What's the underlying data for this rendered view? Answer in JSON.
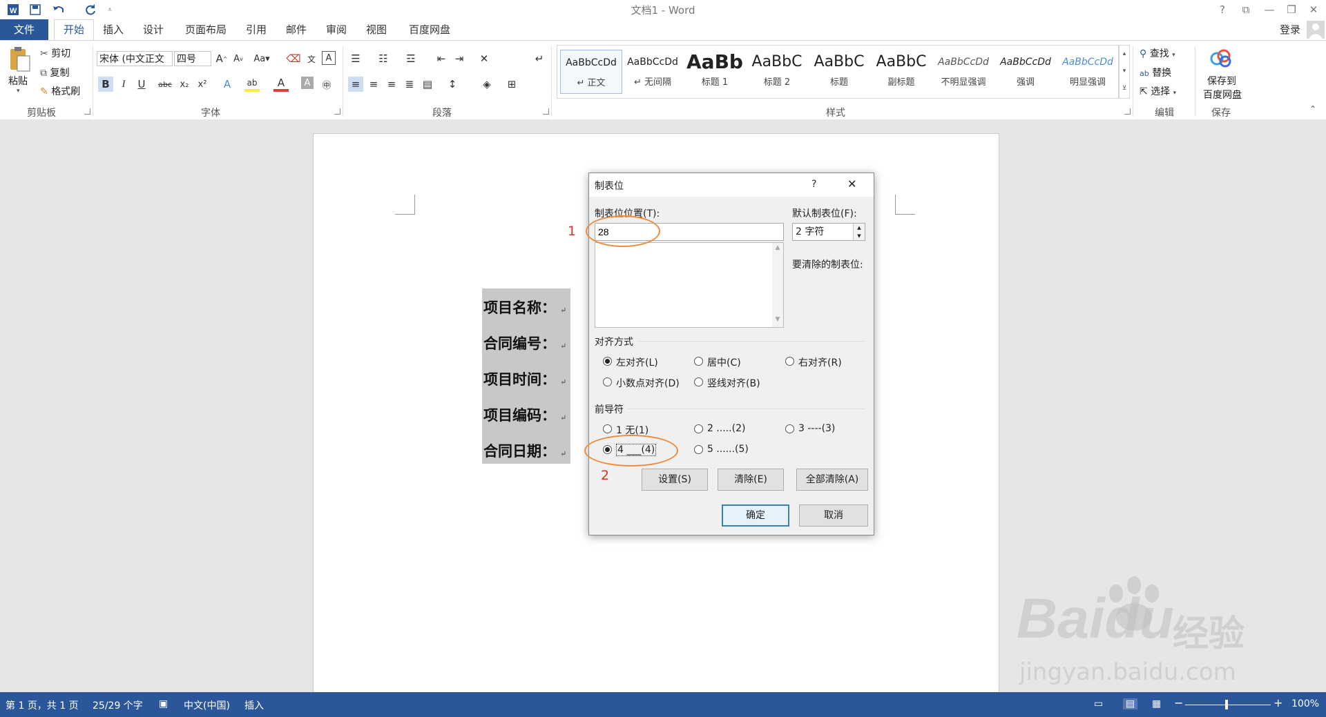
{
  "titlebar": {
    "title": "文档1 - Word",
    "qat_icons": [
      "word-logo-icon",
      "save-icon",
      "undo-icon",
      "redo-icon",
      "customize-qat-icon"
    ],
    "window_buttons": {
      "help": "?",
      "ribbon_options": "⧉",
      "minimize": "—",
      "restore": "❐",
      "close": "✕"
    }
  },
  "tabs": {
    "file": "文件",
    "home": "开始",
    "insert": "插入",
    "design": "设计",
    "layout": "页面布局",
    "references": "引用",
    "mailings": "邮件",
    "review": "审阅",
    "view": "视图",
    "baidu": "百度网盘",
    "login": "登录"
  },
  "ribbon": {
    "clipboard": {
      "paste": "粘贴",
      "cut": "剪切",
      "copy": "复制",
      "format_painter": "格式刷",
      "label": "剪贴板"
    },
    "font": {
      "font_name": "宋体 (中文正文",
      "font_size": "四号",
      "label": "字体"
    },
    "paragraph": {
      "label": "段落"
    },
    "styles": {
      "label": "样式",
      "items": [
        {
          "sample": "AaBbCcDd",
          "name": "↵ 正文"
        },
        {
          "sample": "AaBbCcDd",
          "name": "↵ 无间隔"
        },
        {
          "sample": "AaBb",
          "name": "标题 1"
        },
        {
          "sample": "AaBbC",
          "name": "标题 2"
        },
        {
          "sample": "AaBbC",
          "name": "标题"
        },
        {
          "sample": "AaBbC",
          "name": "副标题"
        },
        {
          "sample": "AaBbCcDd",
          "name": "不明显强调"
        },
        {
          "sample": "AaBbCcDd",
          "name": "强调"
        },
        {
          "sample": "AaBbCcDd",
          "name": "明显强调"
        }
      ]
    },
    "editing": {
      "find": "查找",
      "replace": "替换",
      "select": "选择",
      "label": "编辑"
    },
    "save": {
      "line1": "保存到",
      "line2": "百度网盘",
      "label": "保存"
    }
  },
  "document": {
    "lines": [
      "项目名称：",
      "合同编号：",
      "项目时间：",
      "项目编码：",
      "合同日期："
    ],
    "para_mark": "↵"
  },
  "dialog": {
    "title": "制表位",
    "help": "?",
    "close": "✕",
    "tab_position_label": "制表位位置(T):",
    "tab_position_value": "28",
    "default_tab_label": "默认制表位(F):",
    "default_tab_value": "2 字符",
    "to_clear_label": "要清除的制表位:",
    "alignment_label": "对齐方式",
    "alignment_options": [
      "左对齐(L)",
      "居中(C)",
      "右对齐(R)",
      "小数点对齐(D)",
      "竖线对齐(B)"
    ],
    "alignment_selected": "左对齐(L)",
    "leader_label": "前导符",
    "leader_options": [
      "1 无(1)",
      "2 .....(2)",
      "3 ----(3)",
      "4 ___(4)",
      "5 ......(5)"
    ],
    "leader_selected": "4 ___(4)",
    "btn_set": "设置(S)",
    "btn_clear": "清除(E)",
    "btn_clear_all": "全部清除(A)",
    "btn_ok": "确定",
    "btn_cancel": "取消"
  },
  "annotations": {
    "one": "1",
    "two": "2",
    "color": "#e0301e",
    "ellipse_color": "#ef8a3a"
  },
  "statusbar": {
    "page": "第 1 页，共 1 页",
    "words": "25/29 个字",
    "language": "中文(中国)",
    "mode": "插入",
    "zoom": "100%",
    "zoom_minus": "−",
    "zoom_plus": "+"
  },
  "watermark": {
    "brand": "Baidu",
    "cn": "经验",
    "url": "jingyan.baidu.com"
  },
  "colors": {
    "accent": "#2b579a",
    "selection": "#c8c8c8",
    "dialog_bg": "#f0f0f0"
  }
}
